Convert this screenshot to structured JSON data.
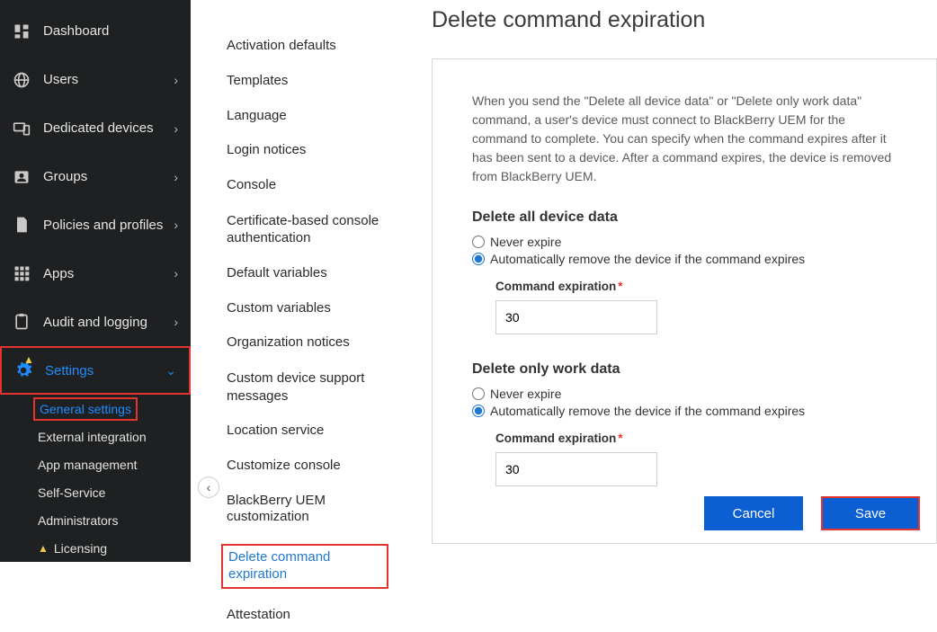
{
  "sidebar": {
    "items": [
      {
        "label": "Dashboard"
      },
      {
        "label": "Users"
      },
      {
        "label": "Dedicated devices"
      },
      {
        "label": "Groups"
      },
      {
        "label": "Policies and profiles"
      },
      {
        "label": "Apps"
      },
      {
        "label": "Audit and logging"
      },
      {
        "label": "Settings"
      }
    ],
    "sub": [
      {
        "label": "General settings"
      },
      {
        "label": "External integration"
      },
      {
        "label": "App management"
      },
      {
        "label": "Self-Service"
      },
      {
        "label": "Administrators"
      },
      {
        "label": "Licensing"
      }
    ]
  },
  "secnav": [
    "Activation defaults",
    "Templates",
    "Language",
    "Login notices",
    "Console",
    "Certificate-based console authentication",
    "Default variables",
    "Custom variables",
    "Organization notices",
    "Custom device support messages",
    "Location service",
    "Customize console",
    "BlackBerry UEM customization",
    "Delete command expiration",
    "Attestation"
  ],
  "page": {
    "title": "Delete command expiration",
    "description": "When you send the \"Delete all device data\" or \"Delete only work data\" command, a user's device must connect to BlackBerry UEM for the command to complete. You can specify when the command expires after it has been sent to a device. After a command expires, the device is removed from BlackBerry UEM.",
    "section1": {
      "title": "Delete all device data",
      "opt1": "Never expire",
      "opt2": "Automatically remove the device if the command expires",
      "field_label": "Command expiration",
      "value": "30"
    },
    "section2": {
      "title": "Delete only work data",
      "opt1": "Never expire",
      "opt2": "Automatically remove the device if the command expires",
      "field_label": "Command expiration",
      "value": "30"
    },
    "buttons": {
      "cancel": "Cancel",
      "save": "Save"
    }
  }
}
